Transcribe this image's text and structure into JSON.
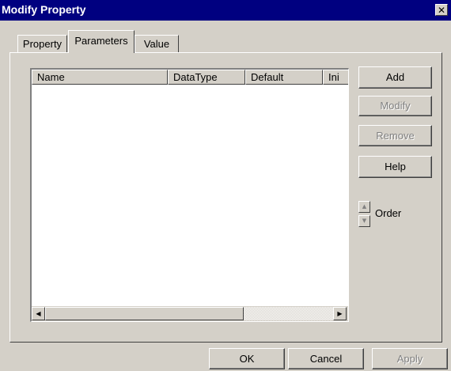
{
  "window": {
    "title": "Modify Property",
    "close_glyph": "✕"
  },
  "tabs": [
    {
      "label": "Property"
    },
    {
      "label": "Parameters"
    },
    {
      "label": "Value"
    }
  ],
  "table": {
    "columns": [
      "Name",
      "DataType",
      "Default",
      "Ini"
    ],
    "rows": []
  },
  "side_buttons": {
    "add": "Add",
    "modify": "Modify",
    "remove": "Remove",
    "help": "Help"
  },
  "order": {
    "label": "Order",
    "up_icon": "arrow-up-icon",
    "down_icon": "arrow-down-icon"
  },
  "footer": {
    "ok": "OK",
    "cancel": "Cancel",
    "apply": "Apply"
  },
  "colors": {
    "titlebar": "#000080",
    "face": "#d4d0c8",
    "disabled_text": "#808080"
  }
}
